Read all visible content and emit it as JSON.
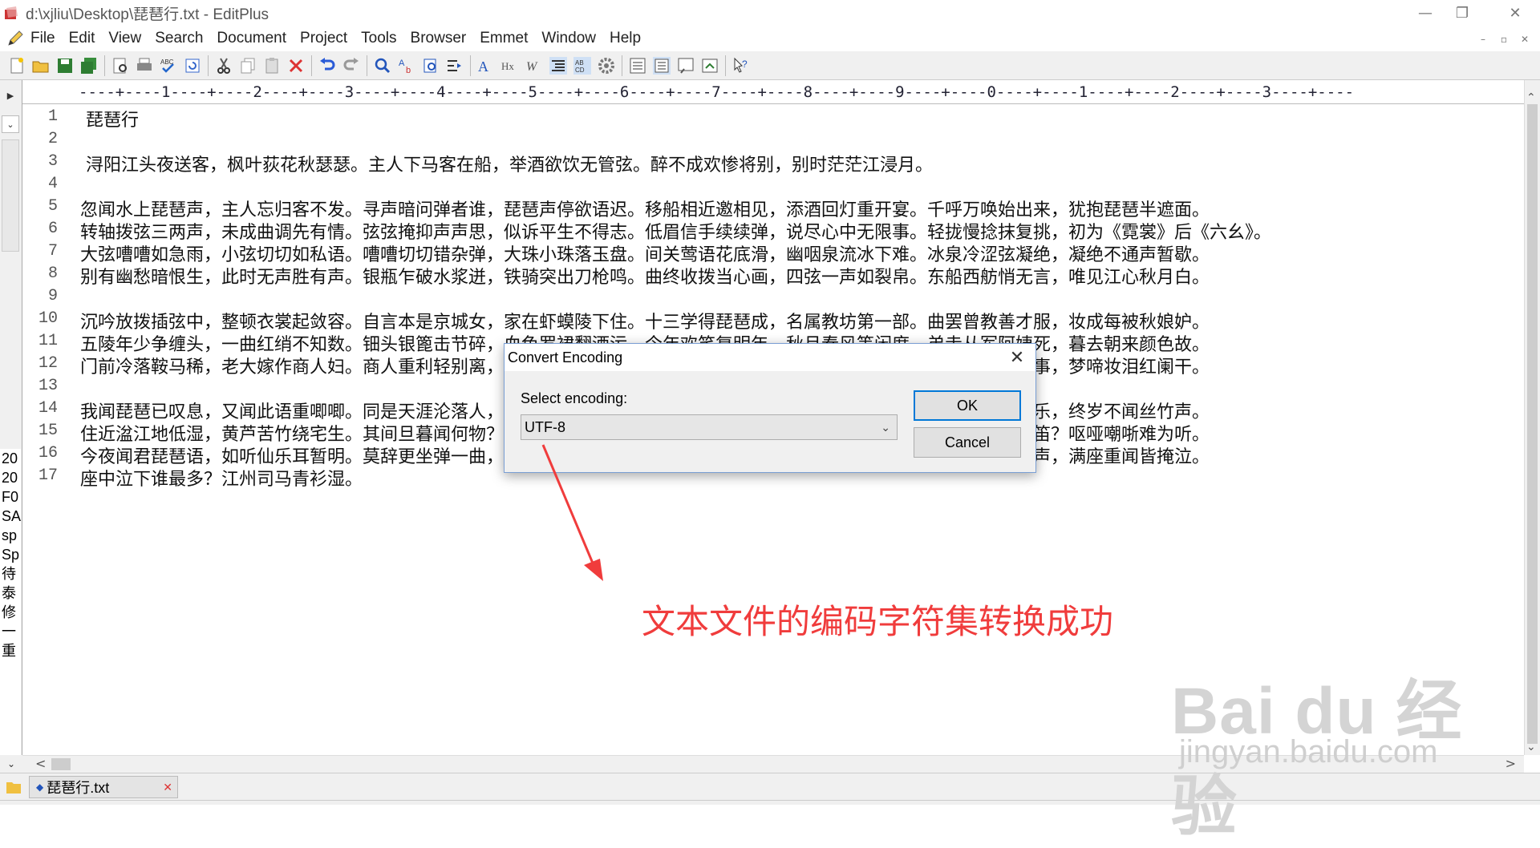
{
  "window": {
    "title": "d:\\xjliu\\Desktop\\琵琶行.txt - EditPlus",
    "minimize_glyph": "—",
    "restore_glyph": "❐",
    "close_glyph": "✕"
  },
  "menu": {
    "items": [
      "File",
      "Edit",
      "View",
      "Search",
      "Document",
      "Project",
      "Tools",
      "Browser",
      "Emmet",
      "Window",
      "Help"
    ],
    "mdi_min": "–",
    "mdi_restore": "▫",
    "mdi_close": "✕"
  },
  "toolbar": {
    "icons": [
      "new-file-icon",
      "open-folder-icon",
      "save-icon",
      "save-all-icon",
      "print-preview-icon",
      "print-icon",
      "spell-check-icon",
      "reload-icon",
      "cut-icon",
      "copy-icon",
      "paste-icon",
      "delete-icon",
      "undo-icon",
      "redo-icon",
      "find-icon",
      "replace-icon",
      "find-in-files-icon",
      "goto-icon",
      "font-icon",
      "hex-icon",
      "word-wrap-icon",
      "indent-icon",
      "abc-icon",
      "settings-icon",
      "view-1-icon",
      "view-2-icon",
      "view-3-icon",
      "browser-icon",
      "help-icon"
    ]
  },
  "ruler": {
    "text": "----+----1----+----2----+----3----+----4----+----5----+----6----+----7----+----8----+----9----+----0----+----1----+----2----+----3----+----"
  },
  "left_panel": {
    "arrow_top": "▶",
    "arrow_down": "⌄",
    "items": [
      "20",
      "20",
      "F0",
      "SA",
      "sp",
      "Sp",
      "待",
      "泰",
      "修",
      "一",
      "重"
    ]
  },
  "editor": {
    "lines": [
      {
        "num": "1",
        "text": " 琵琶行"
      },
      {
        "num": "2",
        "text": ""
      },
      {
        "num": "3",
        "text": " 浔阳江头夜送客，枫叶荻花秋瑟瑟。主人下马客在船，举酒欲饮无管弦。醉不成欢惨将别，别时茫茫江浸月。"
      },
      {
        "num": "4",
        "text": ""
      },
      {
        "num": "5",
        "text": "忽闻水上琵琶声，主人忘归客不发。寻声暗问弹者谁，琵琶声停欲语迟。移船相近邀相见，添酒回灯重开宴。千呼万唤始出来，犹抱琵琶半遮面。"
      },
      {
        "num": "6",
        "text": "转轴拨弦三两声，未成曲调先有情。弦弦掩抑声声思，似诉平生不得志。低眉信手续续弹，说尽心中无限事。轻拢慢捻抹复挑，初为《霓裳》后《六幺》。"
      },
      {
        "num": "7",
        "text": "大弦嘈嘈如急雨，小弦切切如私语。嘈嘈切切错杂弹，大珠小珠落玉盘。间关莺语花底滑，幽咽泉流冰下难。冰泉冷涩弦凝绝，凝绝不通声暂歇。"
      },
      {
        "num": "8",
        "text": "别有幽愁暗恨生，此时无声胜有声。银瓶乍破水浆迸，铁骑突出刀枪鸣。曲终收拨当心画，四弦一声如裂帛。东船西舫悄无言，唯见江心秋月白。"
      },
      {
        "num": "9",
        "text": ""
      },
      {
        "num": "10",
        "text": "沉吟放拨插弦中，整顿衣裳起敛容。自言本是京城女，家在虾蟆陵下住。十三学得琵琶成，名属教坊第一部。曲罢曾教善才服，妆成每被秋娘妒。"
      },
      {
        "num": "11",
        "text": "五陵年少争缠头，一曲红绡不知数。钿头银篦击节碎，血色罗裙翻酒污。今年欢笑复明年，秋月春风等闲度。弟走从军阿姨死，暮去朝来颜色故。"
      },
      {
        "num": "12",
        "text": "门前冷落鞍马稀，老大嫁作商人妇。商人重利轻别离，前月浮梁买茶去。去来江口守空船，绕船月明江水寒。夜深忽梦少年事，梦啼妆泪红阑干。"
      },
      {
        "num": "13",
        "text": ""
      },
      {
        "num": "14",
        "text": "我闻琵琶已叹息，又闻此语重唧唧。同是天涯沦落人，相逢何必曾相识！我从去年辞帝京，谪居卧病浔阳城。浔阳地僻无音乐，终岁不闻丝竹声。"
      },
      {
        "num": "15",
        "text": "住近湓江地低湿，黄芦苦竹绕宅生。其间旦暮闻何物？杜鹃啼血猿哀鸣。春江花朝秋月夜，往往取酒还独倾。岂无山歌与村笛？呕哑嘲哳难为听。"
      },
      {
        "num": "16",
        "text": "今夜闻君琵琶语，如听仙乐耳暂明。莫辞更坐弹一曲，为君翻作琵琶行。感我此言良久立，却坐促弦弦转急。凄凄不似向前声，满座重闻皆掩泣。"
      },
      {
        "num": "17",
        "text": "座中泣下谁最多？江州司马青衫湿。"
      }
    ]
  },
  "tab": {
    "label": "琵琶行.txt",
    "close_glyph": "✕"
  },
  "dialog": {
    "title": "Convert Encoding",
    "close_glyph": "✕",
    "label": "Select encoding:",
    "selected": "UTF-8",
    "ok": "OK",
    "cancel": "Cancel"
  },
  "annotation": {
    "text": "文本文件的编码字符集转换成功",
    "color": "#f03c3c"
  },
  "watermark": {
    "logo": "Bai du 经验",
    "url": "jingyan.baidu.com"
  },
  "scroll": {
    "up": "⌃",
    "down": "⌄",
    "left": "<",
    "right": ">"
  }
}
